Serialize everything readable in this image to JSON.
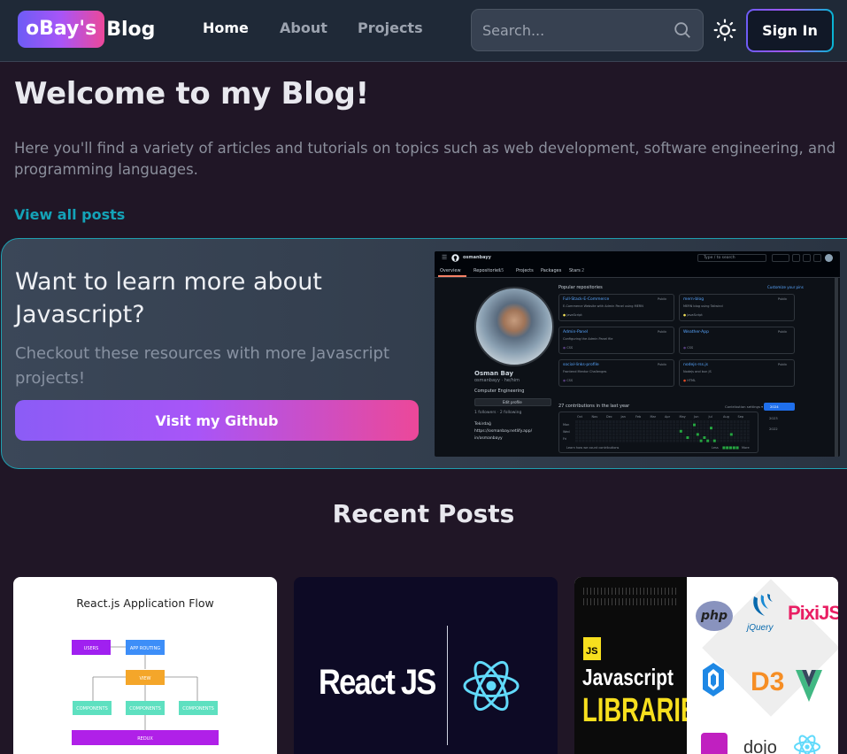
{
  "navbar": {
    "logo_badge": "oBay's",
    "logo_text": "Blog",
    "links": [
      {
        "label": "Home",
        "active": true
      },
      {
        "label": "About",
        "active": false
      },
      {
        "label": "Projects",
        "active": false
      }
    ],
    "search_placeholder": "Search...",
    "sign_in_label": "Sign In"
  },
  "hero": {
    "title": "Welcome to my Blog!",
    "description": "Here you'll find a variety of articles and tutorials on topics such as web development, software engineering, and programming languages.",
    "view_all_label": "View all posts"
  },
  "cta": {
    "title": "Want to learn more about Javascript?",
    "description": "Checkout these resources with more Javascript projects!",
    "button_label": "Visit my Github",
    "screenshot": {
      "username": "osmanbayy",
      "search_placeholder": "Type / to search",
      "tabs": [
        {
          "label": "Overview"
        },
        {
          "label": "Repositories",
          "count": "15"
        },
        {
          "label": "Projects"
        },
        {
          "label": "Packages"
        },
        {
          "label": "Stars",
          "count": "2"
        }
      ],
      "name": "Osman Bay",
      "handle": "osmanbayy · he/him",
      "bio": "Computer Engineering",
      "edit_profile": "Edit profile",
      "followers": "1 followers · 2 following",
      "details": [
        "Tekirdağ",
        "https://osmanbay.netlify.app/",
        "in/osmanbayy"
      ],
      "popular_title": "Popular repositories",
      "customize": "Customize your pins",
      "repos": [
        {
          "name": "Full-Stack-E-Commerce",
          "desc": "E-Commerce Website with Admin Panel using MERN",
          "lang": "JavaScript",
          "badge": "Public"
        },
        {
          "name": "mern-blog",
          "desc": "MERN blog using Tailwind",
          "lang": "JavaScript",
          "badge": "Public"
        },
        {
          "name": "Admin-Panel",
          "desc": "Configuring the Admin Panel file",
          "lang": "CSS",
          "badge": "Public"
        },
        {
          "name": "Weather-App",
          "desc": "",
          "lang": "CSS",
          "badge": "Public"
        },
        {
          "name": "social-links-profile",
          "desc": "Frontend Mentor Challenges",
          "lang": "CSS",
          "badge": "Public"
        },
        {
          "name": "nodejs-rss.js",
          "desc": "Nodejs and bun JS",
          "lang": "HTML",
          "badge": "Public"
        }
      ],
      "contrib_title": "27 contributions in the last year",
      "contrib_settings": "Contribution settings ▾",
      "months": [
        "Oct",
        "Nov",
        "Dec",
        "Jan",
        "Feb",
        "Mar",
        "Apr",
        "May",
        "Jun",
        "Jul",
        "Aug",
        "Sep"
      ],
      "days": [
        "Mon",
        "Wed",
        "Fri"
      ],
      "years": [
        "2024",
        "2023",
        "2022"
      ],
      "learn_text": "Learn how we count contributions",
      "legend_less": "Less",
      "legend_more": "More"
    }
  },
  "recent": {
    "title": "Recent Posts",
    "cards": [
      {
        "title": "React.js Application Flow",
        "nodes": [
          "USERS",
          "APP ROUTING",
          "VIEW",
          "COMPONENTS",
          "COMPONENTS",
          "COMPONENTS",
          "REDUX"
        ]
      },
      {
        "title": "React JS"
      },
      {
        "badge": "JS",
        "title_line1": "Javascript",
        "title_line2": "LIBRARIES",
        "logos": [
          "php",
          "jQuery",
          "PixiJS",
          "D3",
          "dojo"
        ]
      }
    ]
  },
  "colors": {
    "accent_teal": "#14a3b8",
    "gradient_purple": "#8b5cf6",
    "gradient_pink": "#ec4899",
    "background": "#201626",
    "navbar": "#1f2937"
  }
}
